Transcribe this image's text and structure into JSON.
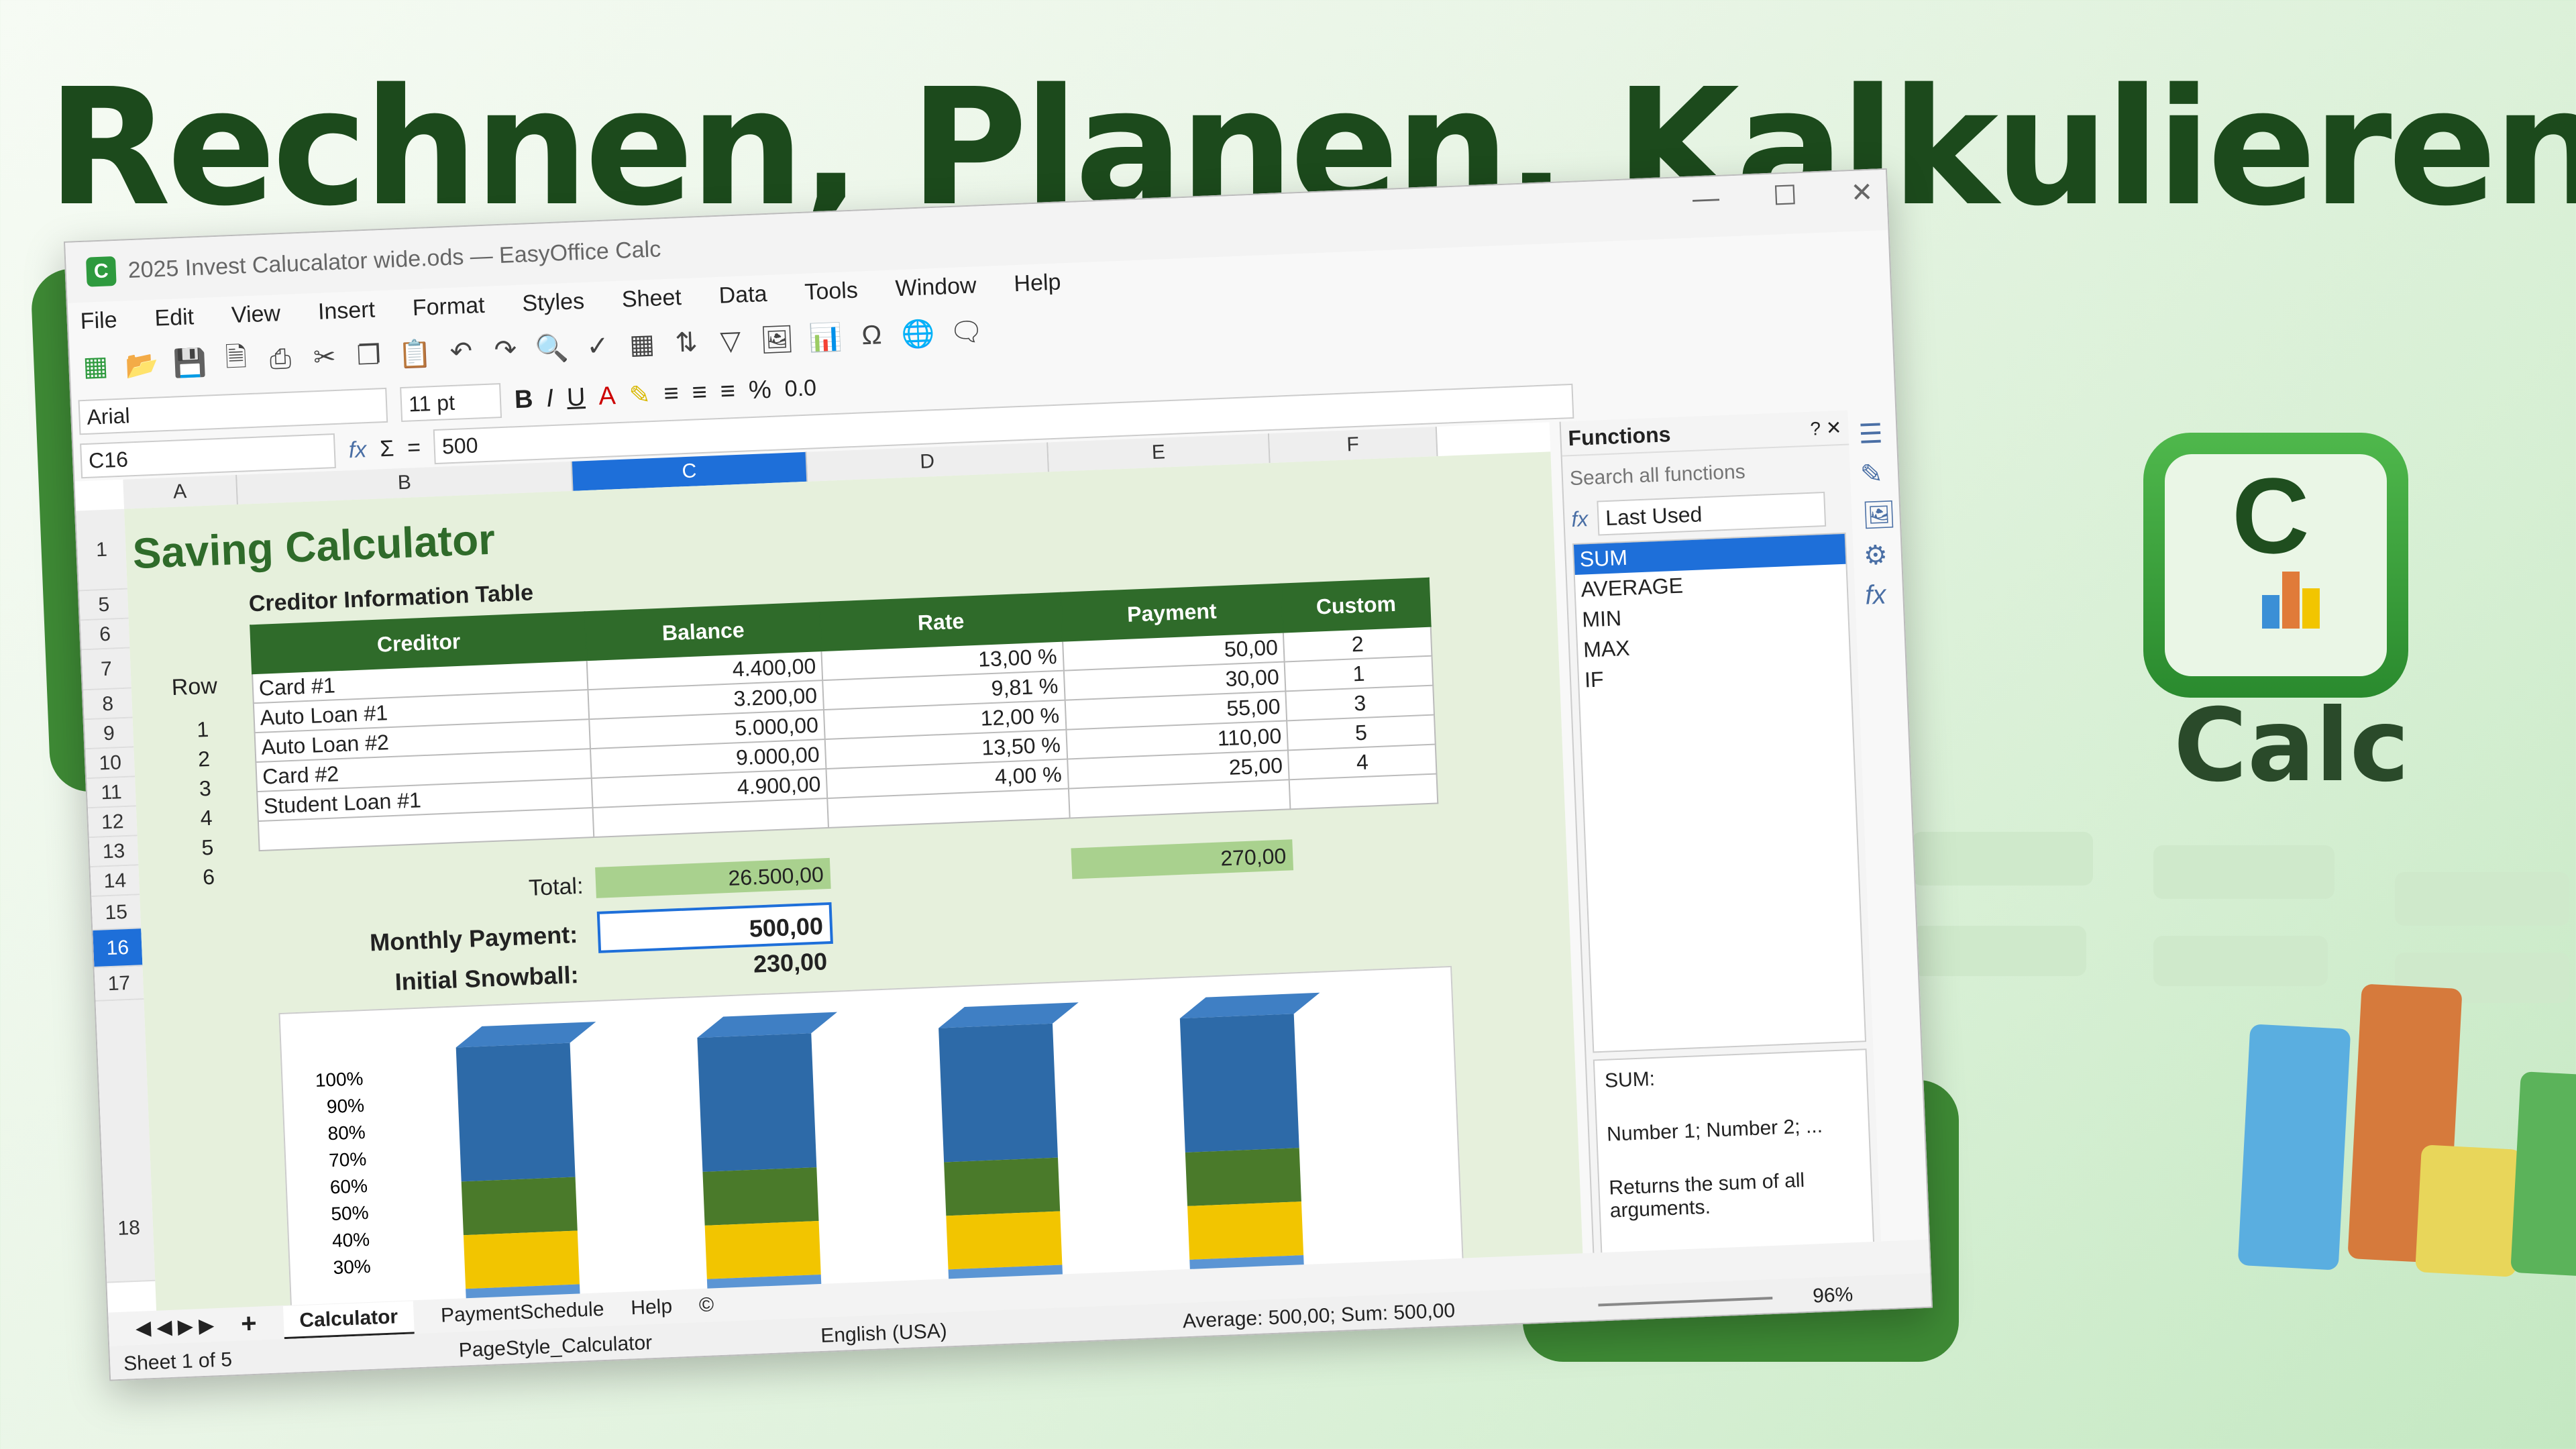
{
  "headline": "Rechnen, Planen, Kalkulieren",
  "logo": {
    "letter": "C",
    "word": "Calc"
  },
  "window": {
    "title": "2025 Invest Calucalator wide.ods — EasyOffice Calc",
    "app_letter": "C",
    "menu": [
      "File",
      "Edit",
      "View",
      "Insert",
      "Format",
      "Styles",
      "Sheet",
      "Data",
      "Tools",
      "Window",
      "Help"
    ],
    "font_name": "Arial",
    "font_size": "11 pt",
    "cell_ref": "C16",
    "formula": "500",
    "columns": [
      "A",
      "B",
      "C",
      "D",
      "E",
      "F"
    ],
    "rows": [
      "1",
      "5",
      "6",
      "7",
      "8",
      "9",
      "10",
      "11",
      "12",
      "13",
      "14",
      "15",
      "16",
      "17",
      "18"
    ],
    "sheet_title": "Saving Calculator",
    "table_caption": "Creditor Information Table",
    "row_label": "Row",
    "table_headers": [
      "Creditor",
      "Balance",
      "Rate",
      "Payment",
      "Custom"
    ],
    "table_rows": [
      {
        "row": "1",
        "creditor": "Card #1",
        "balance": "4.400,00",
        "rate": "13,00 %",
        "payment": "50,00",
        "custom": "2"
      },
      {
        "row": "2",
        "creditor": "Auto Loan #1",
        "balance": "3.200,00",
        "rate": "9,81 %",
        "payment": "30,00",
        "custom": "1"
      },
      {
        "row": "3",
        "creditor": "Auto Loan #2",
        "balance": "5.000,00",
        "rate": "12,00 %",
        "payment": "55,00",
        "custom": "3"
      },
      {
        "row": "4",
        "creditor": "Card #2",
        "balance": "9.000,00",
        "rate": "13,50 %",
        "payment": "110,00",
        "custom": "5"
      },
      {
        "row": "5",
        "creditor": "Student Loan #1",
        "balance": "4.900,00",
        "rate": "4,00 %",
        "payment": "25,00",
        "custom": "4"
      },
      {
        "row": "6",
        "creditor": "",
        "balance": "",
        "rate": "",
        "payment": "",
        "custom": ""
      }
    ],
    "total_label": "Total:",
    "total_balance": "26.500,00",
    "total_payment": "270,00",
    "monthly_label": "Monthly Payment:",
    "monthly_value": "500,00",
    "snowball_label": "Initial Snowball:",
    "snowball_value": "230,00",
    "functions": {
      "title": "Functions",
      "search_placeholder": "Search all functions",
      "category": "Last Used",
      "list": [
        "SUM",
        "AVERAGE",
        "MIN",
        "MAX",
        "IF"
      ],
      "desc_name": "SUM:",
      "desc_args": "Number 1; Number 2; ...",
      "desc_text": "Returns the sum of all arguments."
    },
    "tabs": [
      "Calculator",
      "PaymentSchedule",
      "Help",
      "©"
    ],
    "status": {
      "sheet": "Sheet 1 of 5",
      "pagestyle": "PageStyle_Calculator",
      "lang": "English (USA)",
      "summary": "Average: 500,00; Sum: 500,00",
      "zoom": "96%"
    }
  },
  "chart_data": {
    "type": "bar",
    "stacked": true,
    "y_ticks": [
      "100%",
      "90%",
      "80%",
      "70%",
      "60%",
      "50%",
      "40%",
      "30%"
    ],
    "colors": [
      "#2d6aa8",
      "#4a7a2a",
      "#f2c500",
      "#5b95d4"
    ]
  }
}
